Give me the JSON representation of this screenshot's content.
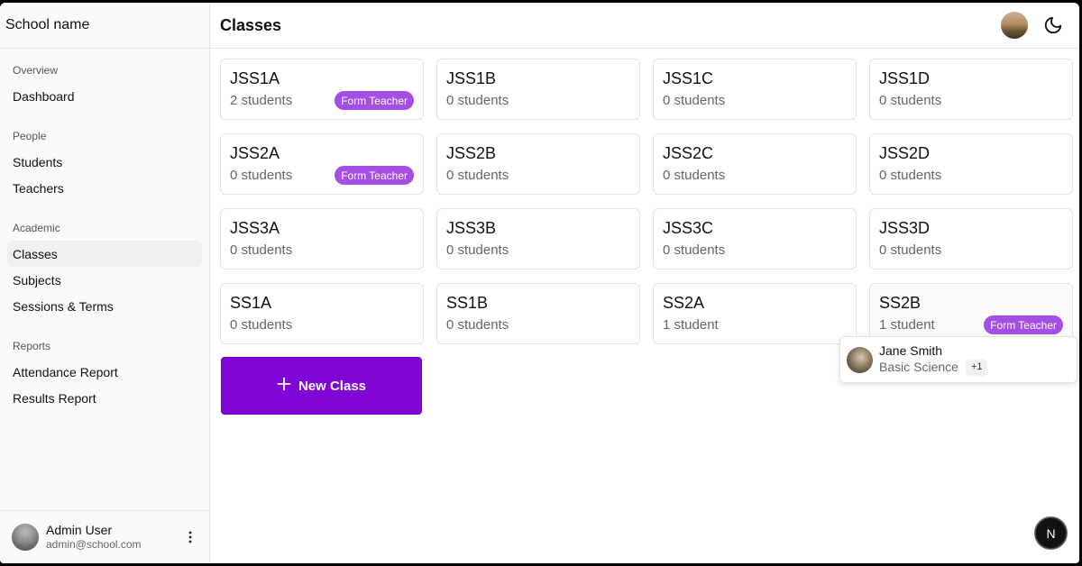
{
  "sidebar": {
    "school_name": "School name",
    "groups": [
      {
        "label": "Overview",
        "items": [
          {
            "label": "Dashboard"
          }
        ]
      },
      {
        "label": "People",
        "items": [
          {
            "label": "Students"
          },
          {
            "label": "Teachers"
          }
        ]
      },
      {
        "label": "Academic",
        "items": [
          {
            "label": "Classes",
            "active": true
          },
          {
            "label": "Subjects"
          },
          {
            "label": "Sessions & Terms"
          }
        ]
      },
      {
        "label": "Reports",
        "items": [
          {
            "label": "Attendance Report"
          },
          {
            "label": "Results Report"
          }
        ]
      }
    ],
    "user": {
      "name": "Admin User",
      "email": "admin@school.com",
      "more_icon": "more-vertical-icon"
    }
  },
  "header": {
    "title": "Classes",
    "theme_icon": "moon-icon"
  },
  "classes": [
    {
      "name": "JSS1A",
      "students": "2 students",
      "badge": "Form Teacher"
    },
    {
      "name": "JSS1B",
      "students": "0 students",
      "badge": ""
    },
    {
      "name": "JSS1C",
      "students": "0 students",
      "badge": ""
    },
    {
      "name": "JSS1D",
      "students": "0 students",
      "badge": ""
    },
    {
      "name": "JSS2A",
      "students": "0 students",
      "badge": "Form Teacher"
    },
    {
      "name": "JSS2B",
      "students": "0 students",
      "badge": ""
    },
    {
      "name": "JSS2C",
      "students": "0 students",
      "badge": ""
    },
    {
      "name": "JSS2D",
      "students": "0 students",
      "badge": ""
    },
    {
      "name": "JSS3A",
      "students": "0 students",
      "badge": ""
    },
    {
      "name": "JSS3B",
      "students": "0 students",
      "badge": ""
    },
    {
      "name": "JSS3C",
      "students": "0 students",
      "badge": ""
    },
    {
      "name": "JSS3D",
      "students": "0 students",
      "badge": ""
    },
    {
      "name": "SS1A",
      "students": "0 students",
      "badge": ""
    },
    {
      "name": "SS1B",
      "students": "0 students",
      "badge": ""
    },
    {
      "name": "SS2A",
      "students": "1 student",
      "badge": ""
    },
    {
      "name": "SS2B",
      "students": "1 student",
      "badge": "Form Teacher"
    }
  ],
  "new_class": {
    "label": "New Class",
    "icon": "plus-icon"
  },
  "popover": {
    "name": "Jane Smith",
    "subject": "Basic Science",
    "extra": "+1"
  },
  "dev_badge": {
    "label": "N"
  },
  "colors": {
    "accent": "#8007d8",
    "badge": "#a44fe3"
  }
}
